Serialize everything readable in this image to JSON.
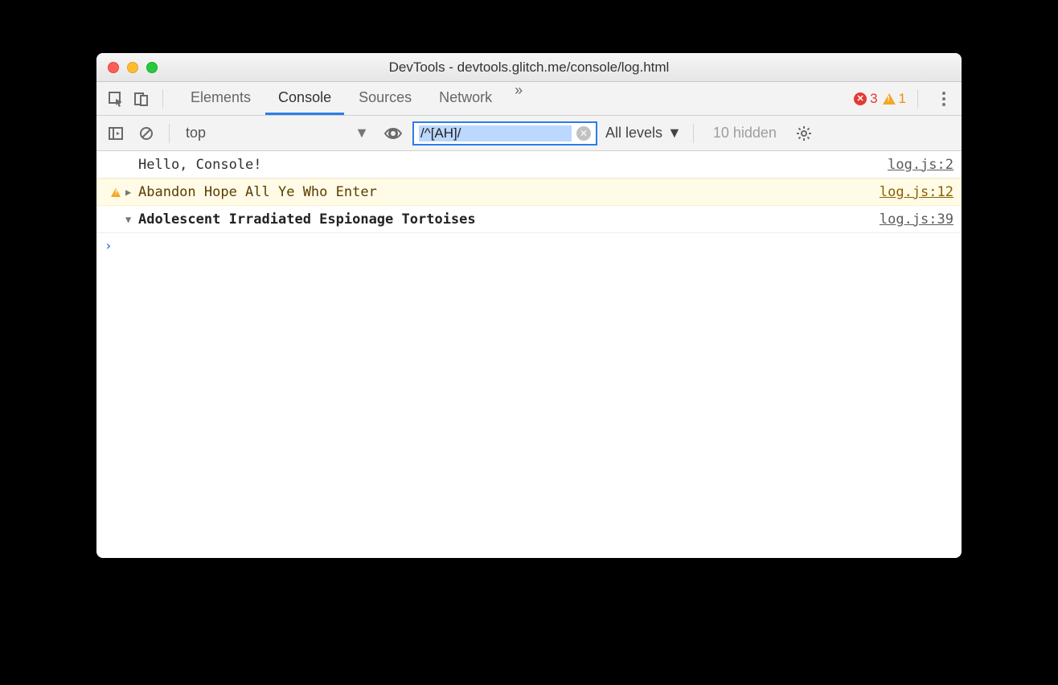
{
  "window": {
    "title": "DevTools - devtools.glitch.me/console/log.html"
  },
  "tabs": {
    "items": [
      "Elements",
      "Console",
      "Sources",
      "Network"
    ],
    "active_index": 1,
    "overflow_glyph": "»"
  },
  "status": {
    "error_count": "3",
    "warning_count": "1"
  },
  "console_toolbar": {
    "context": "top",
    "filter_value": "/^[AH]/",
    "log_levels_label": "All levels",
    "hidden_label": "10 hidden"
  },
  "messages": [
    {
      "type": "log",
      "text": "Hello, Console!",
      "source": "log.js:2",
      "expandable": false
    },
    {
      "type": "warn",
      "text": "Abandon Hope All Ye Who Enter",
      "source": "log.js:12",
      "expandable": true,
      "expanded": false
    },
    {
      "type": "group",
      "text": "Adolescent Irradiated Espionage Tortoises",
      "source": "log.js:39",
      "expandable": true,
      "expanded": true
    }
  ]
}
